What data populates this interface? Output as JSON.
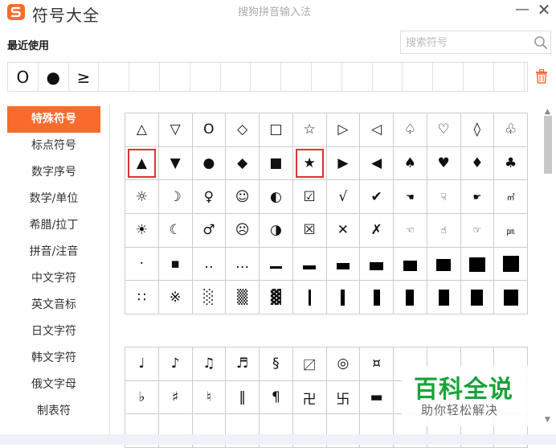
{
  "app": {
    "title": "符号大全",
    "window_title": "搜狗拼音输入法",
    "brand_color": "#f96b2c",
    "minimize_glyph": "—",
    "close_glyph": "✕"
  },
  "recent": {
    "label": "最近使用",
    "items": [
      "O",
      "●",
      "≥"
    ],
    "empty_slots": 14
  },
  "search": {
    "placeholder": "搜索符号",
    "value": ""
  },
  "categories": [
    {
      "label": "特殊符号",
      "active": true
    },
    {
      "label": "标点符号",
      "active": false
    },
    {
      "label": "数字序号",
      "active": false
    },
    {
      "label": "数学/单位",
      "active": false
    },
    {
      "label": "希腊/拉丁",
      "active": false
    },
    {
      "label": "拼音/注音",
      "active": false
    },
    {
      "label": "中文字符",
      "active": false
    },
    {
      "label": "英文音标",
      "active": false
    },
    {
      "label": "日文字符",
      "active": false
    },
    {
      "label": "韩文字符",
      "active": false
    },
    {
      "label": "俄文字母",
      "active": false
    },
    {
      "label": "制表符",
      "active": false
    }
  ],
  "grid1": [
    [
      "△",
      "▽",
      "O",
      "◇",
      "□",
      "☆",
      "▷",
      "◁",
      "♤",
      "♡",
      "◊",
      "♧"
    ],
    [
      "▲",
      "▼",
      "●",
      "◆",
      "■",
      "★",
      "▶",
      "◀",
      "♠",
      "♥",
      "♦",
      "♣"
    ],
    [
      "☼",
      "☽",
      "♀",
      "☺",
      "◐",
      "☑",
      "√",
      "✔",
      "☚",
      "☟",
      "☛",
      "㎡"
    ],
    [
      "☀",
      "☾",
      "♂",
      "☹",
      "◑",
      "☒",
      "✕",
      "✗",
      "☜",
      "☝",
      "☞",
      "㏘"
    ],
    [
      "·",
      "▪",
      "‥",
      "…",
      "▁",
      "▂",
      "▃",
      "▄",
      "▅",
      "▆",
      "▇",
      "█"
    ],
    [
      "∷",
      "※",
      "░",
      "▒",
      "▓",
      "▏",
      "▎",
      "▍",
      "▌",
      "▋",
      "▊",
      "▉"
    ]
  ],
  "grid2": [
    [
      "♩",
      "♪",
      "♫",
      "♬",
      "§",
      "〼",
      "◎",
      "¤",
      "",
      "",
      "",
      ""
    ],
    [
      "♭",
      "♯",
      "♮",
      "‖",
      "¶",
      "卍",
      "卐",
      "▬",
      "",
      "",
      "",
      ""
    ],
    [
      "",
      "",
      "",
      "",
      "",
      "",
      "",
      "",
      "",
      "",
      "",
      ""
    ]
  ],
  "highlights": {
    "row": 1,
    "cols": [
      0,
      5
    ]
  },
  "watermark": {
    "title": "百科全说",
    "subtitle": "助你轻松解决",
    "color": "#1aa33a"
  }
}
